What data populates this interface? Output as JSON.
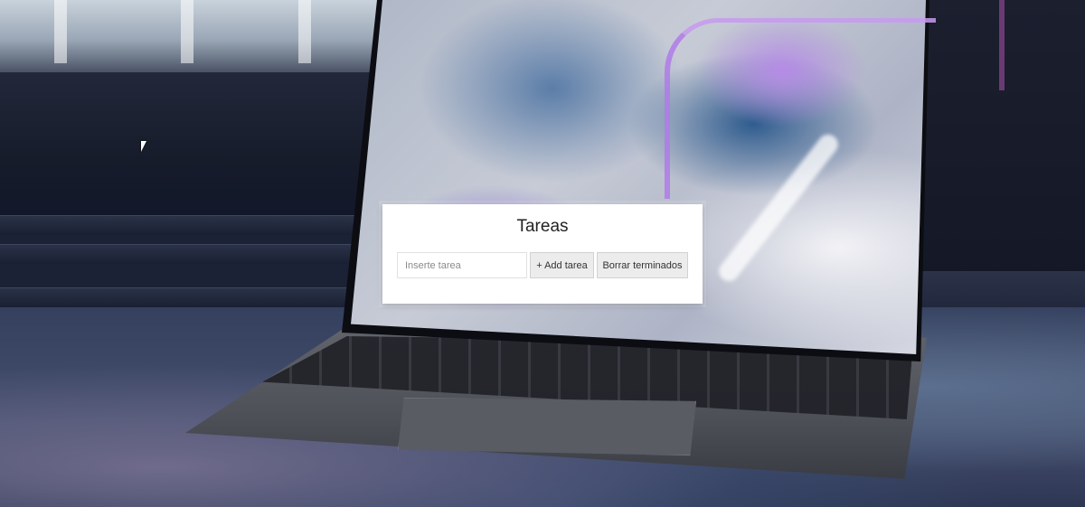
{
  "app": {
    "title": "Tareas"
  },
  "task_input": {
    "value": "",
    "placeholder": "Inserte tarea"
  },
  "buttons": {
    "add_label": "+ Add tarea",
    "clear_label": "Borrar terminados"
  },
  "colors": {
    "card_background": "#ffffff",
    "button_background": "#ececec"
  }
}
